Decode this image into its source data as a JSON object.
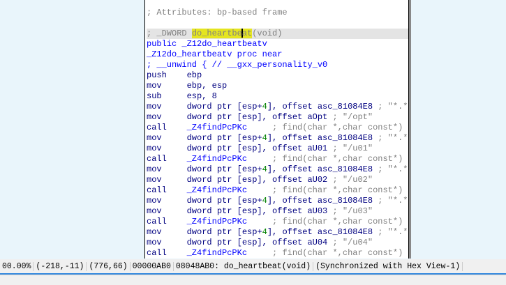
{
  "disasm": {
    "attributes": "; Attributes: bp-based frame",
    "decl_prefix": "; _DWORD ",
    "decl_name_a": "do_heartbe",
    "decl_name_b": "at",
    "decl_suffix": "(void)",
    "public_line": "public _Z12do_heartbeatv",
    "proc_line": "_Z12do_heartbeatv proc near",
    "unwind_line": "; __unwind { // __gxx_personality_v0",
    "lines": [
      {
        "mn": "push",
        "ops": "ebp"
      },
      {
        "mn": "mov",
        "ops": "ebp, esp"
      },
      {
        "mn": "sub",
        "ops": "esp, 8"
      }
    ],
    "blocks": [
      {
        "path": "aOpt",
        "str": "\"/opt\""
      },
      {
        "path": "aU01",
        "str": "\"/u01\""
      },
      {
        "path": "aU02",
        "str": "\"/u02\""
      },
      {
        "path": "aU03",
        "str": "\"/u03\""
      },
      {
        "path": "aU04",
        "str": "\"/u04\""
      }
    ],
    "mov_mn": "mov",
    "call_mn": "call",
    "esp4_a": "dword ptr [esp+",
    "esp4_num": "4",
    "esp4_b": "], offset asc_81084E8 ",
    "esp4_cm": "; \"*.*\"",
    "esp_a": "dword ptr [esp], offset ",
    "call_fn": "_Z4findPcPKc",
    "call_cm": "; find(char *,char const*)"
  },
  "status": {
    "zoom": "00.00%",
    "coord1": "(-218,-11)",
    "coord2": "(776,66)",
    "offset": "00000AB0",
    "location": "08048AB0: do_heartbeat(void)",
    "sync": "(Synchronized with Hex View-1)"
  }
}
